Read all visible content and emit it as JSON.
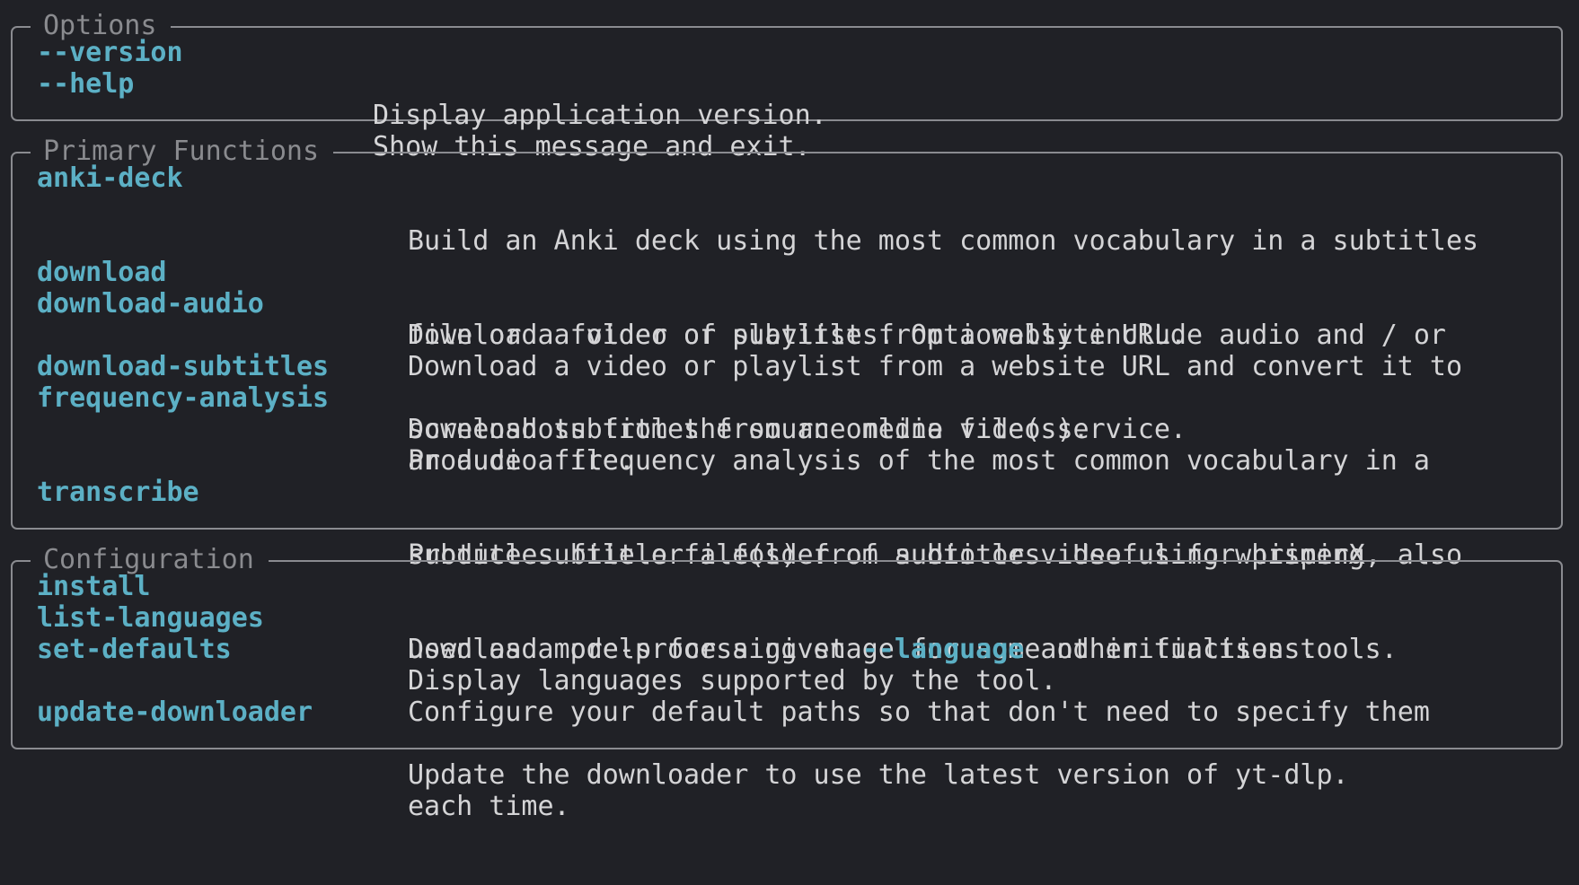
{
  "colors": {
    "background": "#202126",
    "border": "#8a8b90",
    "command": "#5cb0c5",
    "text": "#d4d4d6",
    "title": "#8a8b8f"
  },
  "options": {
    "title": "Options",
    "items": [
      {
        "command": "--version",
        "description": [
          "Display application version."
        ]
      },
      {
        "command": "--help",
        "description": [
          "Show this message and exit."
        ]
      }
    ]
  },
  "primary": {
    "title": "Primary Functions",
    "items": [
      {
        "command": "anki-deck",
        "description": [
          "Build an Anki deck using the most common vocabulary in a subtitles",
          "file or a folder of subtitles. Optionally include audio and / or",
          "screenshots from the source media file(s)."
        ]
      },
      {
        "command": "download",
        "description": [
          "Download a video or playlist from a website URL."
        ]
      },
      {
        "command": "download-audio",
        "description": [
          "Download a video or playlist from a website URL and convert it to",
          "an audio file."
        ]
      },
      {
        "command": "download-subtitles",
        "description": [
          "Download subtitles from an online video service."
        ]
      },
      {
        "command": "frequency-analysis",
        "description": [
          "Produce a frequency analysis of the most common vocabulary in a",
          "subtitles file or a folder of subtitles. Useful for priming, also",
          "used as a pre-processing stage for some other functions."
        ]
      },
      {
        "command": "transcribe",
        "description": [
          "Produce subtitle file(s) from audio or video using whisperX."
        ]
      }
    ]
  },
  "config": {
    "title": "Configuration",
    "items": [
      {
        "command": "install",
        "description_before": "Download models for a given ",
        "description_option": "--language",
        "description_after": " and initialises tools."
      },
      {
        "command": "list-languages",
        "description": [
          "Display languages supported by the tool."
        ]
      },
      {
        "command": "set-defaults",
        "description": [
          "Configure your default paths so that don't need to specify them",
          "each time."
        ]
      },
      {
        "command": "update-downloader",
        "description": [
          "Update the downloader to use the latest version of yt-dlp."
        ]
      }
    ]
  }
}
